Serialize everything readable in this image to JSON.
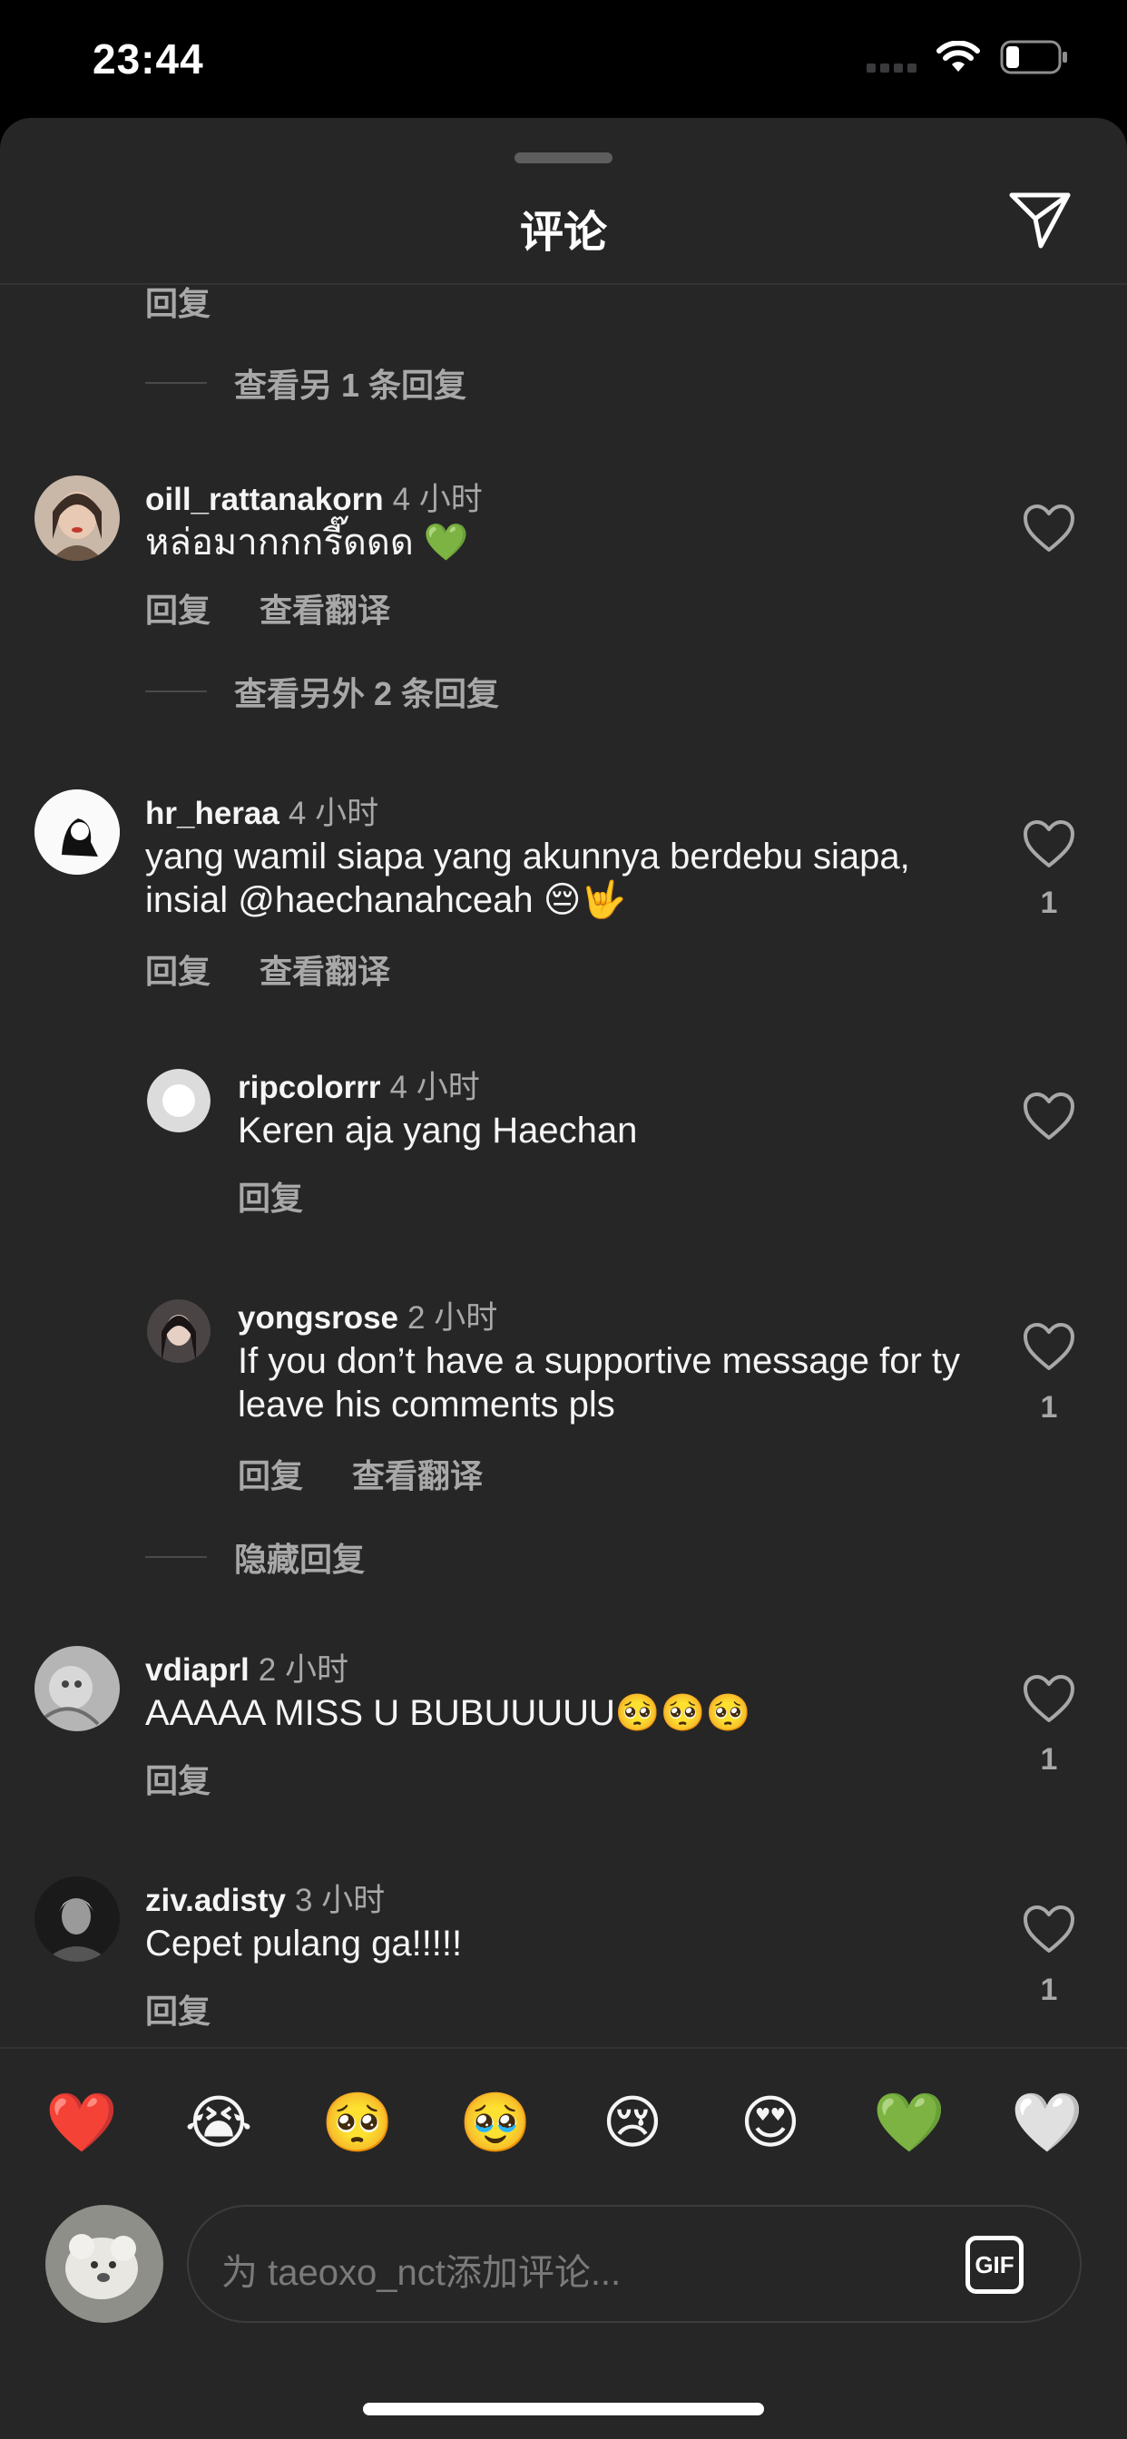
{
  "status": {
    "time": "23:44"
  },
  "sheet": {
    "title": "评论"
  },
  "top_partial": {
    "reply_label": "回复",
    "view_more": "查看另 1 条回复"
  },
  "comments": [
    {
      "user": "oill_rattanakorn",
      "time": "4 小时",
      "text": "หล่อมากกกรี๊ดดด 💚",
      "reply": "回复",
      "translate": "查看翻译",
      "likes": "",
      "view_more": "查看另外 2 条回复"
    },
    {
      "user": "hr_heraa",
      "time": "4 小时",
      "text": "yang wamil siapa yang akunnya berdebu siapa, insial @haechanahceah 😔🤟",
      "reply": "回复",
      "translate": "查看翻译",
      "likes": "1"
    },
    {
      "user": "ripcolorrr",
      "time": "4 小时",
      "text": "Keren aja yang Haechan",
      "reply": "回复",
      "likes": ""
    },
    {
      "user": "yongsrose",
      "time": "2 小时",
      "text": "If you don’t have a supportive message for ty leave his comments pls",
      "reply": "回复",
      "translate": "查看翻译",
      "likes": "1",
      "hide_replies": "隐藏回复"
    },
    {
      "user": "vdiaprl",
      "time": "2 小时",
      "text": "AAAAA MISS U BUBUUUUU🥺🥺🥺",
      "reply": "回复",
      "likes": "1"
    },
    {
      "user": "ziv.adisty",
      "time": "3 小时",
      "text": "Cepet pulang ga!!!!!",
      "reply": "回复",
      "likes": "1"
    }
  ],
  "emoji_bar": [
    "❤️",
    "😭",
    "🥺",
    "🥹",
    "😢",
    "😍",
    "💚",
    "🤍"
  ],
  "composer": {
    "placeholder": "为 taeoxo_nct添加评论...",
    "gif_label": "GIF"
  },
  "colors": {
    "background": "#262626",
    "text": "#f5f5f5",
    "muted": "#a8a8a8"
  }
}
